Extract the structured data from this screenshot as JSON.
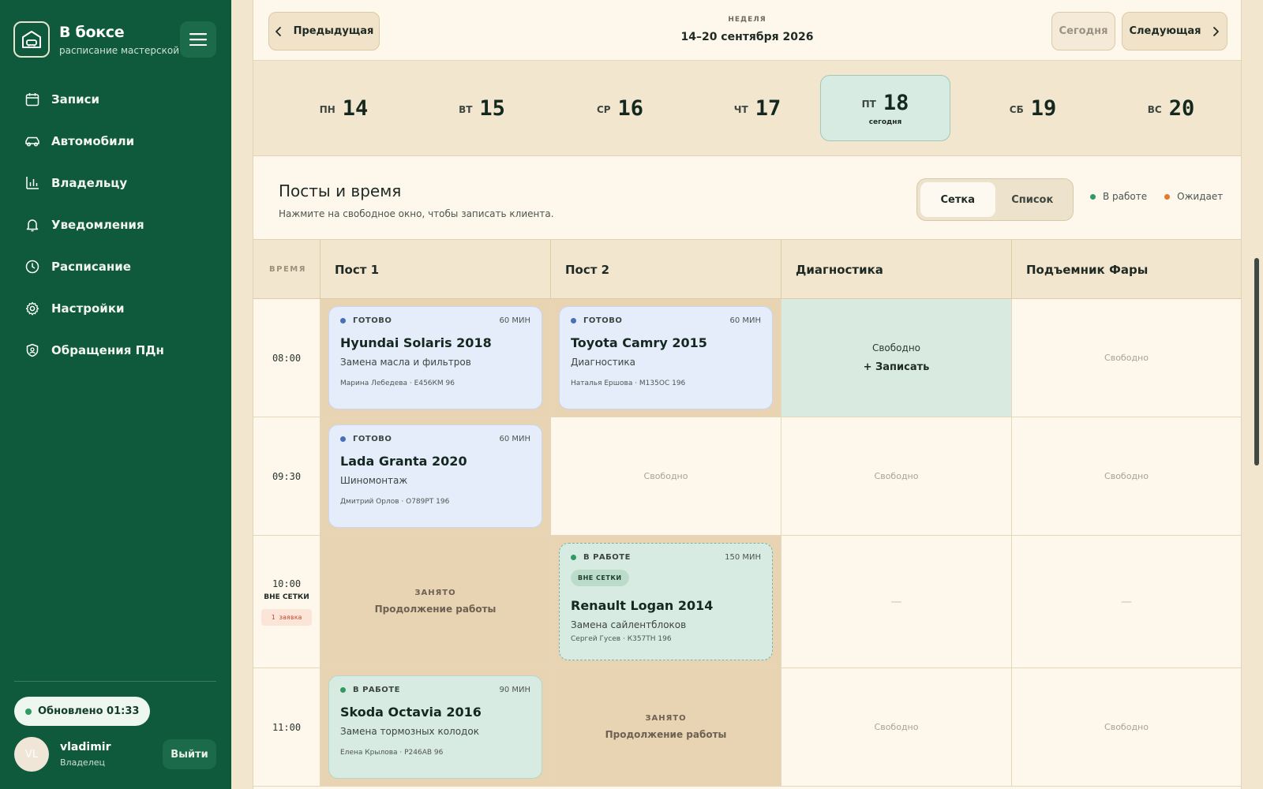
{
  "brand": {
    "title": "В боксе",
    "subtitle": "расписание мастерской"
  },
  "nav": [
    {
      "label": "Записи",
      "icon": "calendar-icon"
    },
    {
      "label": "Автомобили",
      "icon": "car-icon"
    },
    {
      "label": "Владельцу",
      "icon": "bar-chart-icon"
    },
    {
      "label": "Уведомления",
      "icon": "bell-icon"
    },
    {
      "label": "Расписание",
      "icon": "clock-icon"
    },
    {
      "label": "Настройки",
      "icon": "gear-icon"
    },
    {
      "label": "Обращения ПДн",
      "icon": "shield-icon"
    }
  ],
  "status": {
    "updated": "Обновлено 01:33"
  },
  "user": {
    "initials": "VL",
    "name": "vladimir",
    "role": "Владелец",
    "logout": "Выйти"
  },
  "week": {
    "prev": "Предыдущая",
    "label": "НЕДЕЛЯ",
    "range": "14–20 сентября 2026",
    "today": "Сегодня",
    "next": "Следующая"
  },
  "days": [
    {
      "name": "ПН",
      "num": "14"
    },
    {
      "name": "ВТ",
      "num": "15"
    },
    {
      "name": "СР",
      "num": "16"
    },
    {
      "name": "ЧТ",
      "num": "17"
    },
    {
      "name": "ПТ",
      "num": "18",
      "today": "сегодня"
    },
    {
      "name": "СБ",
      "num": "19"
    },
    {
      "name": "ВС",
      "num": "20"
    }
  ],
  "posts": {
    "title": "Посты и время",
    "subtitle": "Нажмите на свободное окно, чтобы записать клиента.",
    "view_grid": "Сетка",
    "view_list": "Список",
    "legend_work": "В работе",
    "legend_wait": "Ожидает",
    "legend_work_color": "#2f9a62",
    "legend_wait_color": "#e07a2e"
  },
  "grid": {
    "time_header": "ВРЕМЯ",
    "columns": [
      "Пост 1",
      "Пост 2",
      "Диагностика",
      "Подъемник Фары"
    ],
    "free": "Свободно",
    "book": "Записать",
    "busy_label": "ЗАНЯТО",
    "busy_sub": "Продолжение работы",
    "dash": "—",
    "rows": [
      {
        "time": "08:00"
      },
      {
        "time": "09:30"
      },
      {
        "time": "10:00",
        "extra": "ВНЕ СЕТКИ",
        "badge": "1 заявка"
      },
      {
        "time": "11:00"
      }
    ],
    "cards": {
      "c1": {
        "status": "ГОТОВО",
        "duration": "60 МИН",
        "title": "Hyundai Solaris 2018",
        "service": "Замена масла и фильтров",
        "client": "Марина Лебедева · Е456КМ 96"
      },
      "c2": {
        "status": "ГОТОВО",
        "duration": "60 МИН",
        "title": "Toyota Camry 2015",
        "service": "Диагностика",
        "client": "Наталья Ершова · М135ОС 196"
      },
      "c3": {
        "status": "ГОТОВО",
        "duration": "60 МИН",
        "title": "Lada Granta 2020",
        "service": "Шиномонтаж",
        "client": "Дмитрий Орлов · О789РТ 196"
      },
      "c4": {
        "status": "В РАБОТЕ",
        "duration": "150 МИН",
        "tag": "ВНЕ СЕТКИ",
        "title": "Renault Logan 2014",
        "service": "Замена сайлентблоков",
        "client": "Сергей Гусев · К357ТН 196"
      },
      "c5": {
        "status": "В РАБОТЕ",
        "duration": "90 МИН",
        "title": "Skoda Octavia 2016",
        "service": "Замена тормозных колодок",
        "client": "Елена Крылова · Р246АВ 96"
      }
    }
  }
}
